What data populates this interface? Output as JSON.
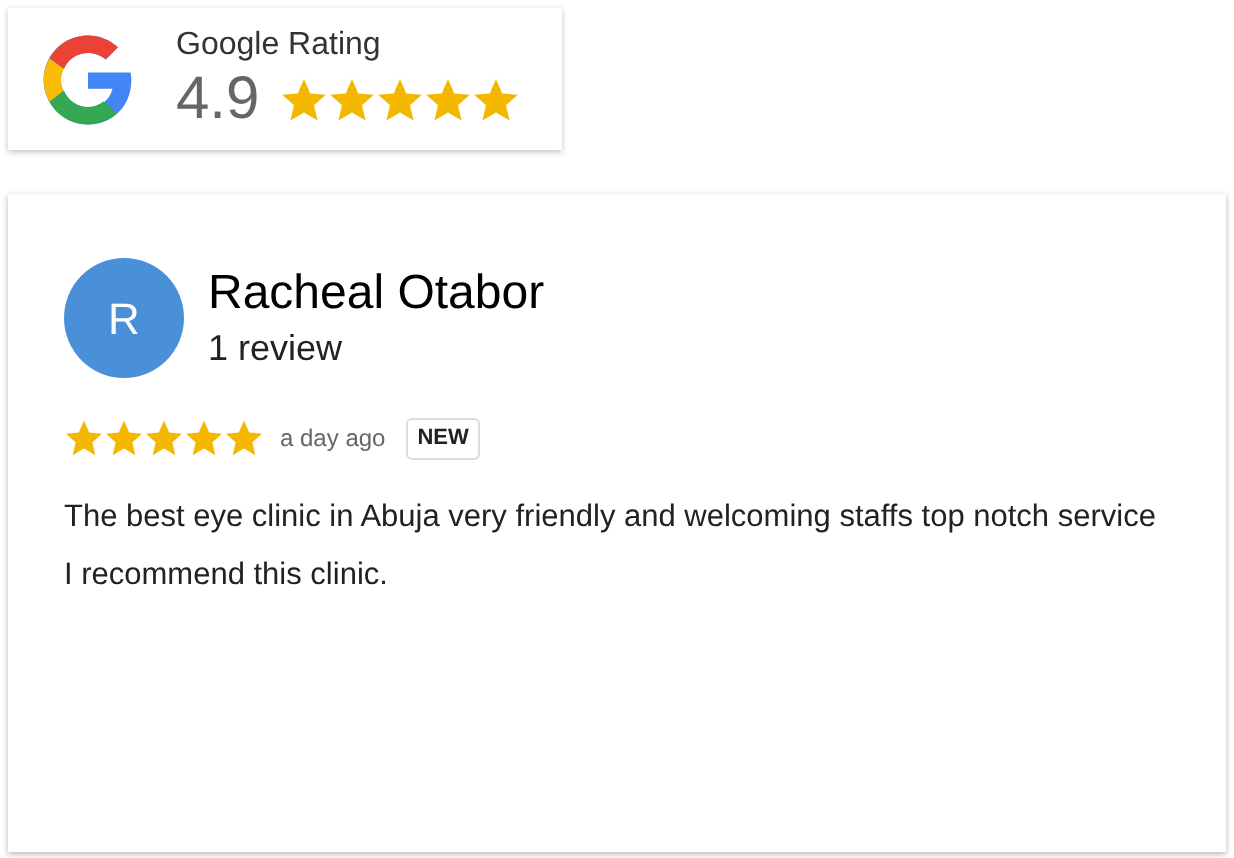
{
  "rating_badge": {
    "title": "Google Rating",
    "score": "4.9",
    "stars": 5
  },
  "review": {
    "avatar_letter": "R",
    "name": "Racheal Otabor",
    "review_count": "1 review",
    "stars": 5,
    "time": "a day ago",
    "tag": "NEW",
    "text": "The best eye clinic in Abuja very friendly and welcoming staffs top notch service I recommend this clinic."
  }
}
